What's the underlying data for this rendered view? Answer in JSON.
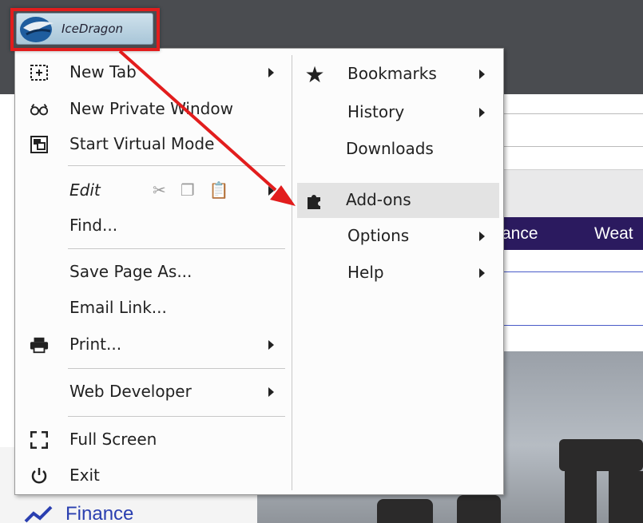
{
  "app_button": {
    "label": "IceDragon"
  },
  "menu": {
    "left": {
      "new_tab": "New Tab",
      "new_private_window": "New Private Window",
      "start_virtual_mode": "Start Virtual Mode",
      "edit": "Edit",
      "find": "Find...",
      "save_page_as": "Save Page As...",
      "email_link": "Email Link...",
      "print": "Print...",
      "web_developer": "Web Developer",
      "full_screen": "Full Screen",
      "exit": "Exit"
    },
    "right": {
      "bookmarks": "Bookmarks",
      "history": "History",
      "downloads": "Downloads",
      "addons": "Add-ons",
      "options": "Options",
      "help": "Help"
    }
  },
  "background": {
    "nav_finance": "ance",
    "nav_weather": "Weat",
    "sidebar_link": "Finance"
  },
  "colors": {
    "annotation": "#e21d1d",
    "nav_bg": "#2b1a5f",
    "link": "#2a3fb0"
  }
}
